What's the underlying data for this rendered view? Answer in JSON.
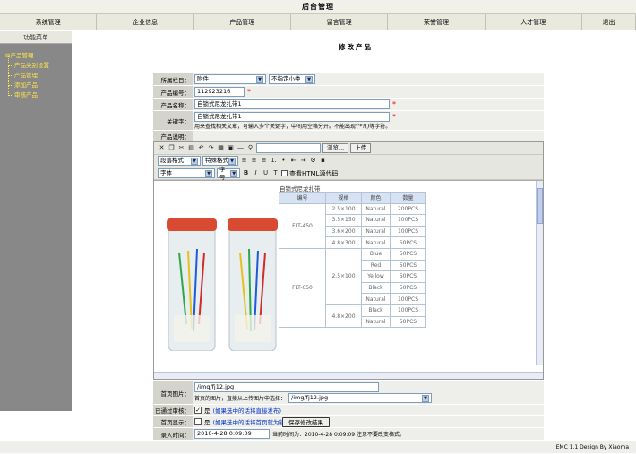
{
  "header": {
    "title": "后台管理"
  },
  "nav": [
    "系统管理",
    "企业信息",
    "产品管理",
    "留言管理",
    "荣誉管理",
    "人才管理",
    "退出"
  ],
  "sidebar": {
    "title": "功能菜单",
    "root": "产品管理",
    "items": [
      "产品类别设置",
      "产品管理",
      "添加产品",
      "审核产品"
    ]
  },
  "page": {
    "title": "修改产品"
  },
  "form": {
    "category_label": "所属栏目：",
    "category1": "附件",
    "category2": "不指定小类",
    "code_label": "产品编号：",
    "code_value": "112923216",
    "name_label": "产品名称：",
    "name_value": "自锁式尼龙扎带1",
    "keyword_label": "关键字：",
    "keyword_value": "自锁式尼龙扎带1",
    "keyword_hint": "用来查找相关文章，可输入多个关键字，中间用空格分开。不能出现\"'*?()等字符。",
    "desc_label": "产品说明：",
    "image_label": "首页图片：",
    "image_value": "/img/fj12.jpg",
    "image_hint": "首页的图片，直接从上传图片中选择：",
    "image_select": "/img/fj12.jpg",
    "audit_label": "已通过审核：",
    "audit_text": "是",
    "audit_note": "(如果选中的话将直接发布)",
    "home_label": "首页显示：",
    "home_text": "是",
    "home_note": "(如果选中的话将首页就为新产品显示)",
    "time_label": "录入时间：",
    "time_value": "2010-4-28 0:09:09",
    "time_note": "当前时间为：2010-4-28 0:09:09 注意不要改变格式。",
    "save_label": "保存修改结果"
  },
  "editor": {
    "browse_label": "浏览...",
    "upload_label": "上传",
    "paragraph": "段落格式",
    "style": "特殊格式",
    "font": "字体",
    "size": "字号",
    "html_label": "查看HTML源代码",
    "content_title": "自锁式尼龙扎带"
  },
  "spec_table": {
    "headers": [
      "编号",
      "规格",
      "颜色",
      "数量"
    ],
    "rows": [
      [
        "FLT-450",
        "2.5×100",
        "Natural",
        "200PCS"
      ],
      [
        "",
        "3.5×150",
        "Natural",
        "100PCS"
      ],
      [
        "",
        "3.6×200",
        "Natural",
        "100PCS"
      ],
      [
        "",
        "4.8×300",
        "Natural",
        "50PCS"
      ],
      [
        "FLT-650",
        "2.5×100",
        "Blue",
        "50PCS"
      ],
      [
        "",
        "",
        "Red",
        "50PCS"
      ],
      [
        "",
        "",
        "Yellow",
        "50PCS"
      ],
      [
        "",
        "",
        "Black",
        "50PCS"
      ],
      [
        "",
        "",
        "Natural",
        "100PCS"
      ],
      [
        "",
        "4.8×200",
        "Black",
        "100PCS"
      ],
      [
        "",
        "",
        "Natural",
        "50PCS"
      ]
    ]
  },
  "footer": {
    "text": "EMC 1.1  Design By Xiaoma"
  }
}
